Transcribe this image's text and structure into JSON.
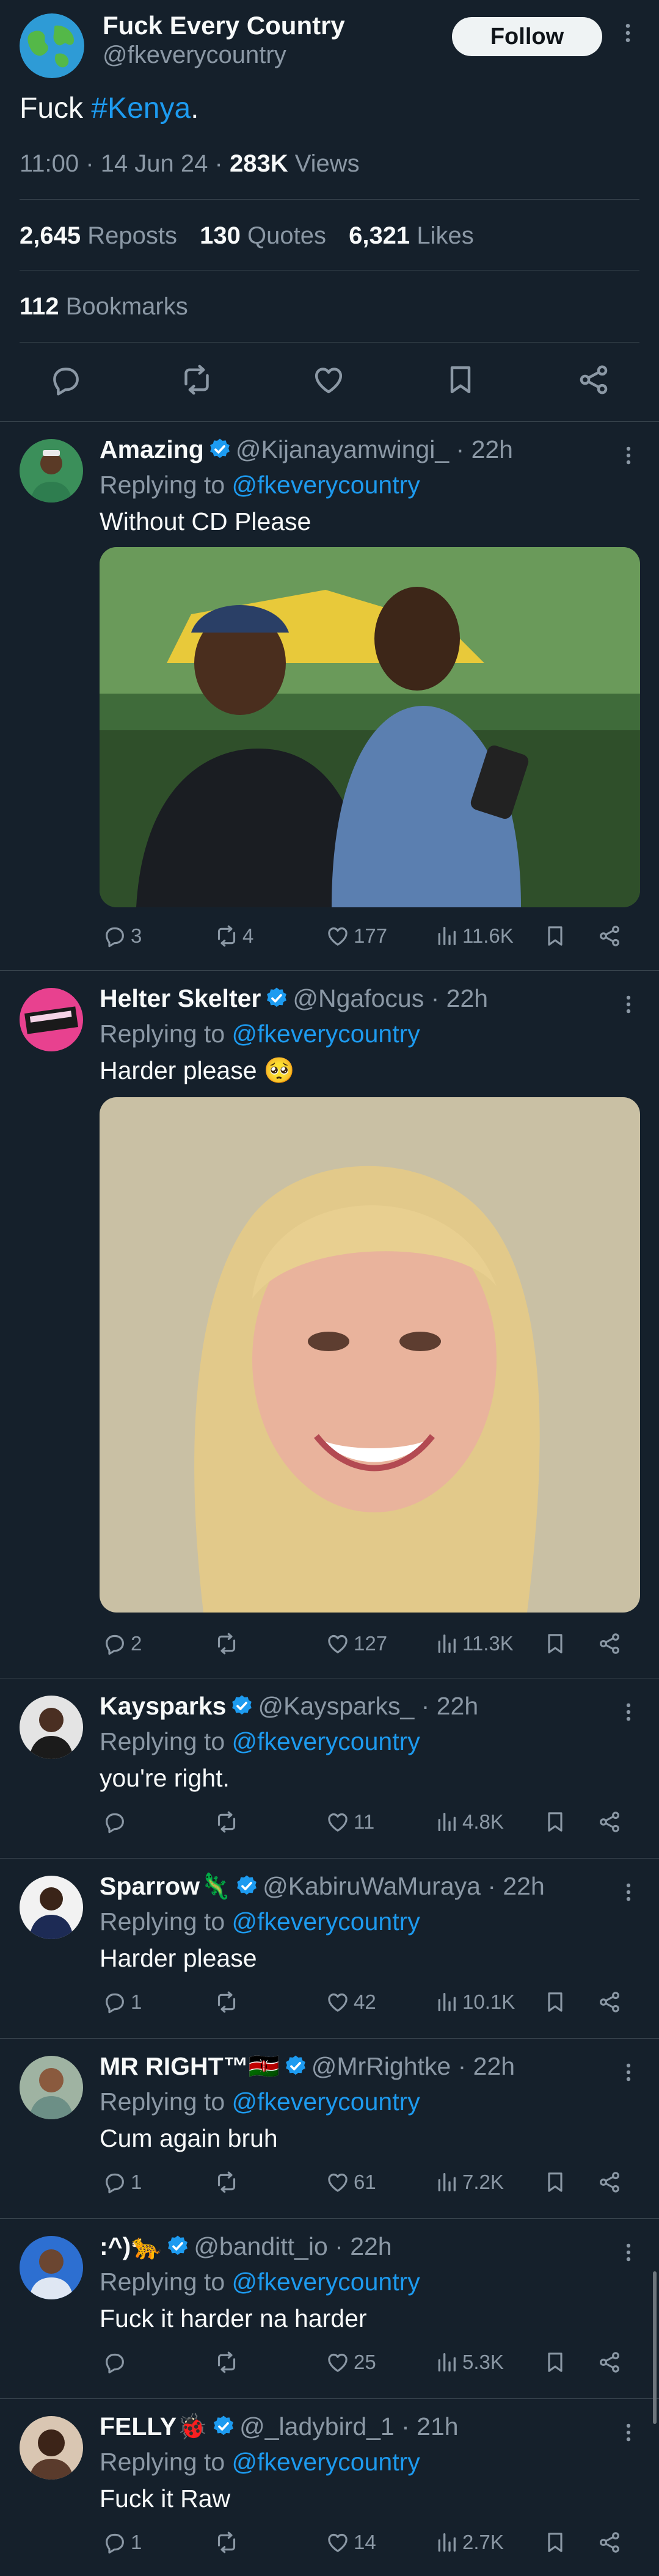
{
  "main_tweet": {
    "author_name": "Fuck Every Country",
    "author_handle": "@fkeverycountry",
    "follow_label": "Follow",
    "text_prefix": "Fuck ",
    "hashtag": "#Kenya",
    "text_suffix": ".",
    "time": "11:00",
    "date": "14 Jun 24",
    "views_count": "283K",
    "views_label": " Views",
    "reposts_count": "2,645",
    "reposts_label": "Reposts",
    "quotes_count": "130",
    "quotes_label": "Quotes",
    "likes_count": "6,321",
    "likes_label": "Likes",
    "bookmarks_count": "112",
    "bookmarks_label": "Bookmarks"
  },
  "replies": [
    {
      "name": "Amazing",
      "verified": true,
      "handle": "@Kijanayamwingi_",
      "age": "22h",
      "replying_label": "Replying to ",
      "replying_to": "@fkeverycountry",
      "text": "Without CD Please",
      "replies": "3",
      "reposts": "4",
      "likes": "177",
      "views": "11.6K"
    },
    {
      "name": "Helter Skelter",
      "verified": true,
      "handle": "@Ngafocus",
      "age": "22h",
      "replying_label": "Replying to ",
      "replying_to": "@fkeverycountry",
      "text": "Harder please 🥺",
      "replies": "2",
      "reposts": "",
      "likes": "127",
      "views": "11.3K"
    },
    {
      "name": "Kaysparks",
      "verified": true,
      "handle": "@Kaysparks_",
      "age": "22h",
      "replying_label": "Replying to ",
      "replying_to": "@fkeverycountry",
      "text": "you're right.",
      "replies": "",
      "reposts": "",
      "likes": "11",
      "views": "4.8K"
    },
    {
      "name": "Sparrow🦎",
      "verified": true,
      "handle": "@KabiruWaMuraya",
      "age": "22h",
      "replying_label": "Replying to ",
      "replying_to": "@fkeverycountry",
      "text": "Harder please",
      "replies": "1",
      "reposts": "",
      "likes": "42",
      "views": "10.1K"
    },
    {
      "name": "MR RIGHT™🇰🇪",
      "verified": true,
      "handle": "@MrRightke",
      "age": "22h",
      "replying_label": "Replying to ",
      "replying_to": "@fkeverycountry",
      "text": "Cum again bruh",
      "replies": "1",
      "reposts": "",
      "likes": "61",
      "views": "7.2K"
    },
    {
      "name": ":^)🐆",
      "verified": true,
      "handle": "@banditt_io",
      "age": "22h",
      "replying_label": "Replying to ",
      "replying_to": "@fkeverycountry",
      "text": "Fuck it harder na harder",
      "replies": "",
      "reposts": "",
      "likes": "25",
      "views": "5.3K"
    },
    {
      "name": "FELLY🐞",
      "verified": true,
      "handle": "@_ladybird_1",
      "age": "21h",
      "replying_label": "Replying to ",
      "replying_to": "@fkeverycountry",
      "text": "Fuck it Raw",
      "replies": "1",
      "reposts": "",
      "likes": "14",
      "views": "2.7K"
    }
  ],
  "colors": {
    "background": "#15202b",
    "accent": "#1d9bf0",
    "muted": "#8b98a5",
    "divider": "#38444d"
  }
}
